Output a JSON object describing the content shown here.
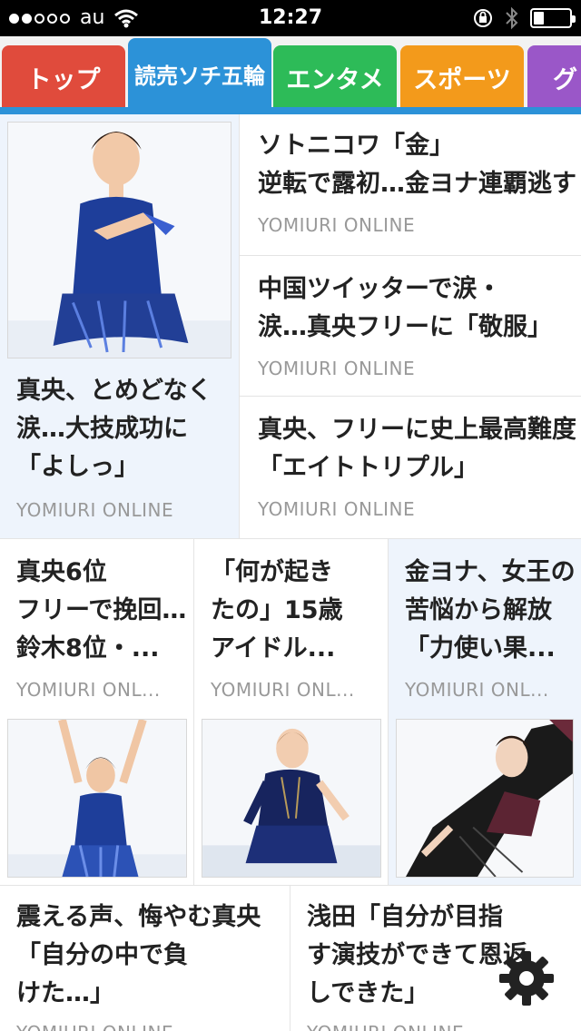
{
  "status_bar": {
    "carrier": "au",
    "time": "12:27",
    "signal_bars_filled": 2,
    "signal_bars_total": 5,
    "battery_level": 0.3
  },
  "tabs": [
    {
      "label": "トップ",
      "color": "#e04b3c",
      "active": false
    },
    {
      "label": "読売ソチ五輪",
      "color": "#2c92d8",
      "active": true
    },
    {
      "label": "エンタメ",
      "color": "#2dbb58",
      "active": false
    },
    {
      "label": "スポーツ",
      "color": "#f39a1b",
      "active": false
    },
    {
      "label": "グ",
      "color": "#9a57c8",
      "active": false
    }
  ],
  "accent_color": "#2c92d8",
  "articles": {
    "featured": {
      "title_lines": [
        "真央、とめどなく",
        "涙…大技成功に",
        "「よしっ」"
      ],
      "source": "YOMIURI ONLINE",
      "image": "skater-hands-on-chest"
    },
    "side": [
      {
        "title_lines": [
          "ソトニコワ「金」",
          "逆転で露初…金ヨナ連覇逃す"
        ],
        "source": "YOMIURI ONLINE"
      },
      {
        "title_lines": [
          "中国ツイッターで涙・",
          "涙…真央フリーに「敬服」"
        ],
        "source": "YOMIURI ONLINE"
      },
      {
        "title_lines": [
          "真央、フリーに史上最高難度",
          "「エイトトリプル」"
        ],
        "source": "YOMIURI ONLINE"
      }
    ],
    "row": [
      {
        "title_lines": [
          "真央6位",
          "フリーで挽回…",
          "鈴木8位・..."
        ],
        "source": "YOMIURI ONL...",
        "image": "skater-arms-raised"
      },
      {
        "title_lines": [
          "「何が起き",
          "たの」15歳",
          "アイドル..."
        ],
        "source": "YOMIURI ONL...",
        "image": "young-skater"
      },
      {
        "title_lines": [
          "金ヨナ、女王の",
          "苦悩から解放",
          "「力使い果..."
        ],
        "source": "YOMIURI ONL...",
        "image": "skater-spin-pose"
      }
    ],
    "bottom": [
      {
        "title_lines": [
          "震える声、悔やむ真央",
          "「自分の中で負",
          "けた…」"
        ],
        "source": "YOMIURI ONLINE"
      },
      {
        "title_lines": [
          "浅田「自分が目指",
          "す演技ができて恩返",
          "しできた」"
        ],
        "source": "YOMIURI ONLINE"
      }
    ]
  },
  "icons": {
    "settings": "gear-icon",
    "wifi": "wifi-icon",
    "rotation_lock": "rotation-lock-icon",
    "bluetooth": "bluetooth-icon"
  }
}
